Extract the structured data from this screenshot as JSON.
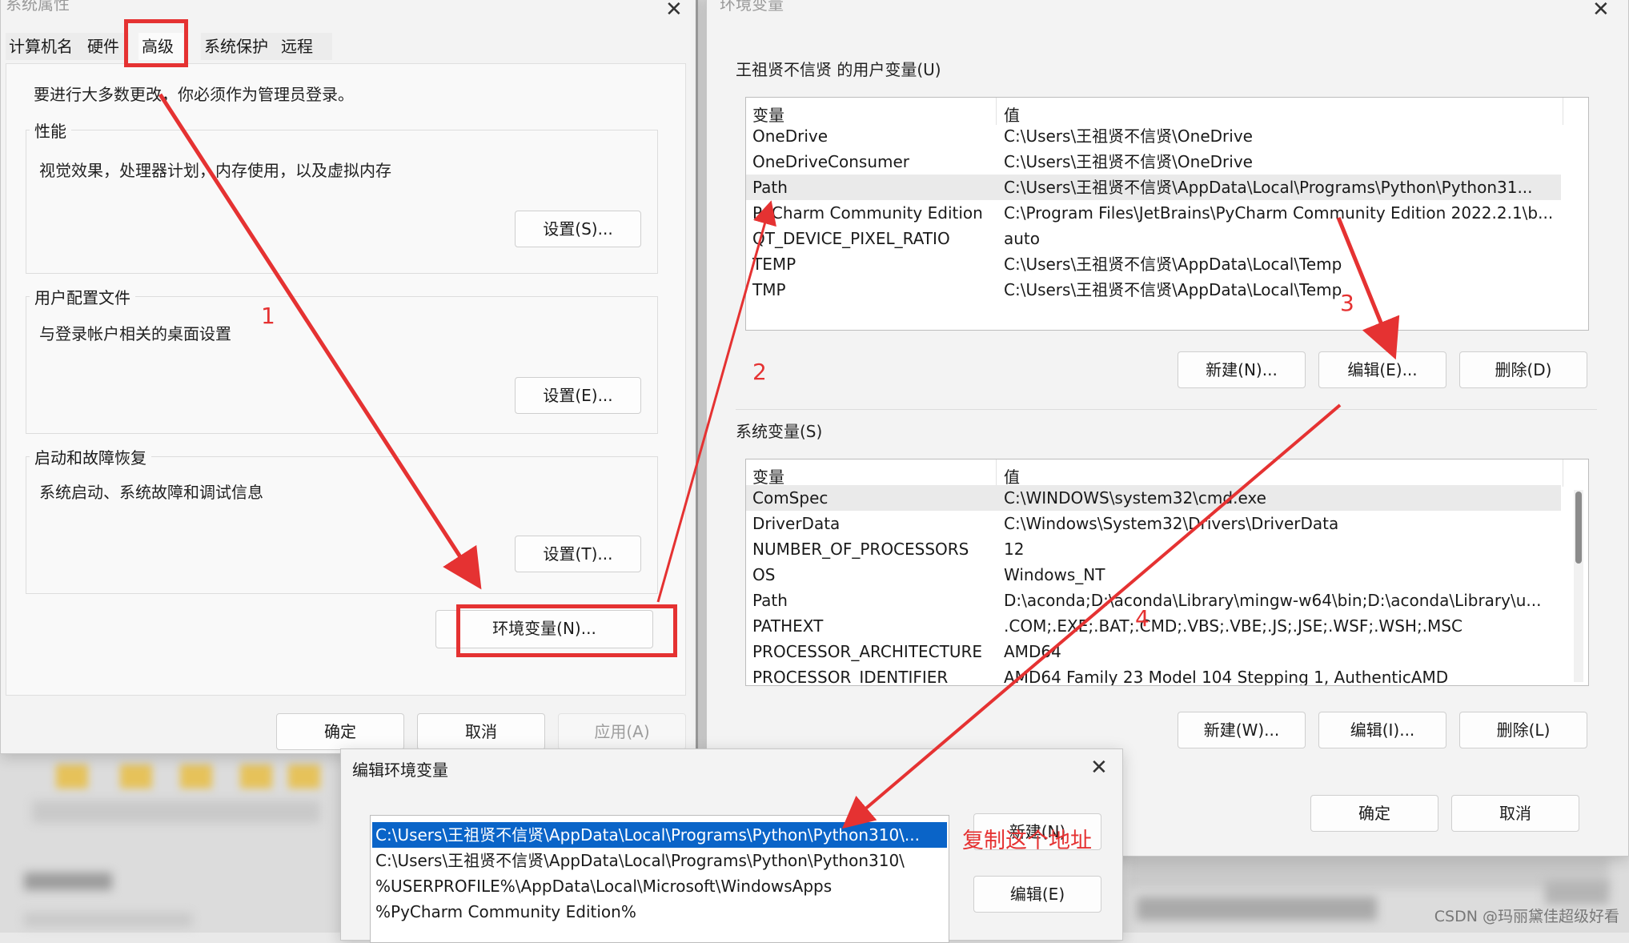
{
  "sysprops": {
    "title": "系统属性",
    "tabs": [
      "计算机名",
      "硬件",
      "高级",
      "系统保护",
      "远程"
    ],
    "notice": "要进行大多数更改，你必须作为管理员登录。",
    "groups": [
      {
        "title": "性能",
        "desc": "视觉效果，处理器计划，内存使用，以及虚拟内存",
        "button": "设置(S)..."
      },
      {
        "title": "用户配置文件",
        "desc": "与登录帐户相关的桌面设置",
        "button": "设置(E)..."
      },
      {
        "title": "启动和故障恢复",
        "desc": "系统启动、系统故障和调试信息",
        "button": "设置(T)..."
      }
    ],
    "env_button": "环境变量(N)...",
    "ok": "确定",
    "cancel": "取消",
    "apply": "应用(A)"
  },
  "envvars": {
    "title": "环境变量",
    "user_section": "王祖贤不信贤 的用户变量(U)",
    "col_var": "变量",
    "col_val": "值",
    "user_vars": [
      {
        "name": "OneDrive",
        "value": "C:\\Users\\王祖贤不信贤\\OneDrive"
      },
      {
        "name": "OneDriveConsumer",
        "value": "C:\\Users\\王祖贤不信贤\\OneDrive"
      },
      {
        "name": "Path",
        "value": "C:\\Users\\王祖贤不信贤\\AppData\\Local\\Programs\\Python\\Python31..."
      },
      {
        "name": "PyCharm Community Edition",
        "value": "C:\\Program Files\\JetBrains\\PyCharm Community Edition 2022.2.1\\b..."
      },
      {
        "name": "QT_DEVICE_PIXEL_RATIO",
        "value": "auto"
      },
      {
        "name": "TEMP",
        "value": "C:\\Users\\王祖贤不信贤\\AppData\\Local\\Temp"
      },
      {
        "name": "TMP",
        "value": "C:\\Users\\王祖贤不信贤\\AppData\\Local\\Temp"
      }
    ],
    "user_buttons": [
      "新建(N)...",
      "编辑(E)...",
      "删除(D)"
    ],
    "system_section": "系统变量(S)",
    "system_vars": [
      {
        "name": "ComSpec",
        "value": "C:\\WINDOWS\\system32\\cmd.exe"
      },
      {
        "name": "DriverData",
        "value": "C:\\Windows\\System32\\Drivers\\DriverData"
      },
      {
        "name": "NUMBER_OF_PROCESSORS",
        "value": "12"
      },
      {
        "name": "OS",
        "value": "Windows_NT"
      },
      {
        "name": "Path",
        "value": "D:\\aconda;D:\\aconda\\Library\\mingw-w64\\bin;D:\\aconda\\Library\\u..."
      },
      {
        "name": "PATHEXT",
        "value": ".COM;.EXE;.BAT;.CMD;.VBS;.VBE;.JS;.JSE;.WSF;.WSH;.MSC"
      },
      {
        "name": "PROCESSOR_ARCHITECTURE",
        "value": "AMD64"
      },
      {
        "name": "PROCESSOR_IDENTIFIER",
        "value": "AMD64 Family 23 Model 104 Stepping 1, AuthenticAMD"
      }
    ],
    "system_buttons": [
      "新建(W)...",
      "编辑(I)...",
      "删除(L)"
    ],
    "ok": "确定",
    "cancel": "取消"
  },
  "editdlg": {
    "title": "编辑环境变量",
    "paths": [
      "C:\\Users\\王祖贤不信贤\\AppData\\Local\\Programs\\Python\\Python310\\...",
      "C:\\Users\\王祖贤不信贤\\AppData\\Local\\Programs\\Python\\Python310\\",
      "%USERPROFILE%\\AppData\\Local\\Microsoft\\WindowsApps",
      "%PyCharm Community Edition%"
    ],
    "new_button": "新建(N)",
    "edit_button": "编辑(E)"
  },
  "annotations": {
    "step1": "1",
    "step2": "2",
    "step3": "3",
    "step4": "4",
    "copy_note": "复制这个地址",
    "red": "#e53232"
  },
  "watermark": "CSDN @玛丽黛佳超级好看",
  "colors": {
    "selection": "#0a64c8",
    "annotation": "#e53232"
  }
}
